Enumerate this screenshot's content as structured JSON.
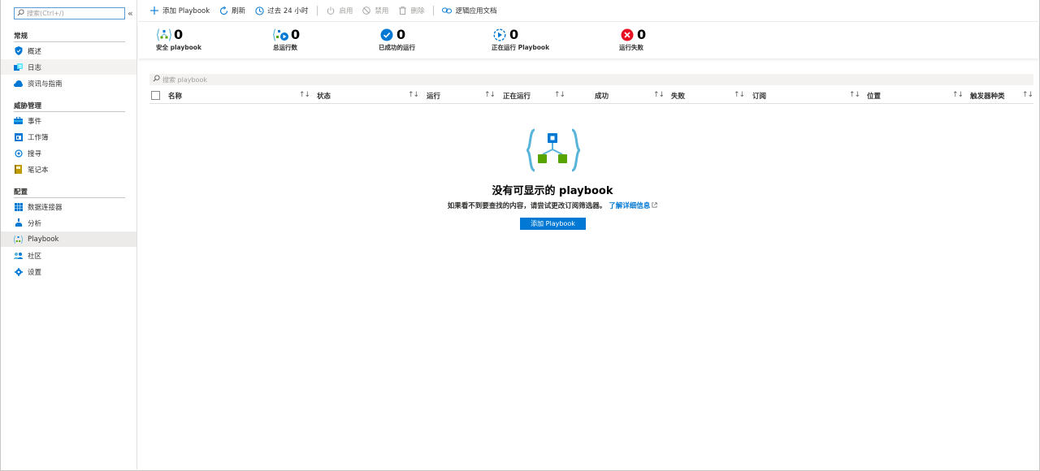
{
  "sidebar": {
    "search_placeholder": "搜索(Ctrl+/)",
    "collapse_glyph": "«",
    "groups": [
      {
        "title": "常规",
        "items": [
          {
            "label": "概述",
            "icon": "shield-icon"
          },
          {
            "label": "日志",
            "icon": "logs-icon"
          },
          {
            "label": "资讯与指南",
            "icon": "cloud-icon"
          }
        ]
      },
      {
        "title": "威胁管理",
        "items": [
          {
            "label": "事件",
            "icon": "briefcase-icon"
          },
          {
            "label": "工作簿",
            "icon": "workbook-icon"
          },
          {
            "label": "搜寻",
            "icon": "hunting-icon"
          },
          {
            "label": "笔记本",
            "icon": "notebook-icon"
          }
        ]
      },
      {
        "title": "配置",
        "items": [
          {
            "label": "数据连接器",
            "icon": "grid-icon"
          },
          {
            "label": "分析",
            "icon": "flask-icon"
          },
          {
            "label": "Playbook",
            "icon": "playbook-icon",
            "active": true
          },
          {
            "label": "社区",
            "icon": "community-icon"
          },
          {
            "label": "设置",
            "icon": "gear-icon"
          }
        ]
      }
    ]
  },
  "toolbar": {
    "add_playbook": "添加 Playbook",
    "refresh": "刷新",
    "time_range": "过去 24 小时",
    "enable": "启用",
    "disable": "禁用",
    "delete": "删除",
    "docs": "逻辑应用文档"
  },
  "stats": [
    {
      "value": "0",
      "label": "安全 playbook",
      "icon": "security-playbook-icon"
    },
    {
      "value": "0",
      "label": "总运行数",
      "icon": "total-runs-icon"
    },
    {
      "value": "0",
      "label": "已成功的运行",
      "icon": "success-icon"
    },
    {
      "value": "0",
      "label": "正在运行 Playbook",
      "icon": "running-icon"
    },
    {
      "value": "0",
      "label": "运行失败",
      "icon": "failed-icon"
    }
  ],
  "grid": {
    "search_placeholder": "搜索 playbook",
    "sort_glyph": "↑↓",
    "columns": [
      "名称",
      "状态",
      "运行",
      "正在运行",
      "成功",
      "失败",
      "订阅",
      "位置",
      "触发器种类"
    ]
  },
  "empty_state": {
    "title": "没有可显示的 playbook",
    "subtitle": "如果看不到要查找的内容，请尝试更改订阅筛选器。",
    "link": "了解详细信息",
    "button": "添加 Playbook"
  },
  "colors": {
    "accent": "#0078d4",
    "success": "#0078d4",
    "failed": "#e81123",
    "active_bg": "#edebe9"
  }
}
